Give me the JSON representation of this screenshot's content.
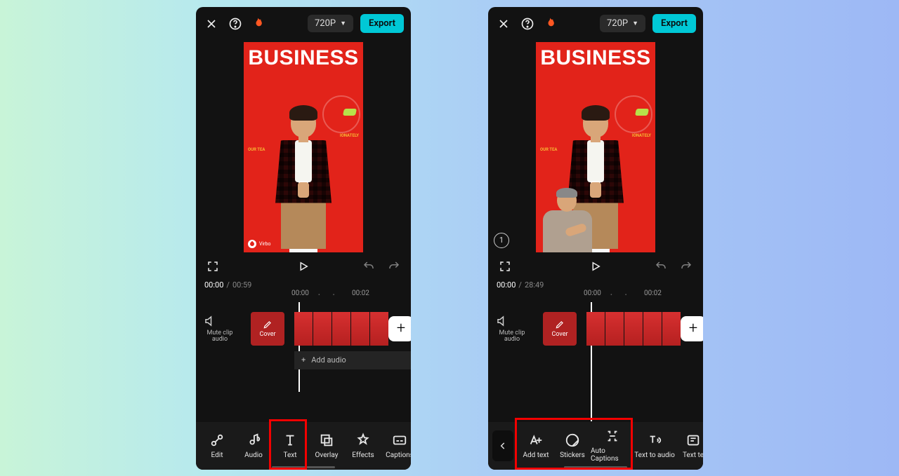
{
  "topbar": {
    "resolution": "720P",
    "export_label": "Export"
  },
  "preview": {
    "title": "BUSINESS",
    "side_text_left": "OUR TEA",
    "side_text_right": "IONATELY",
    "watermark": "Virbo"
  },
  "left": {
    "time_current": "00:00",
    "time_total": "00:59",
    "ruler": {
      "t0": "00:00",
      "t1": "00:02"
    },
    "mute_label": "Mute clip audio",
    "cover_label": "Cover",
    "add_audio_label": "Add audio",
    "tools": [
      {
        "id": "edit",
        "label": "Edit"
      },
      {
        "id": "audio",
        "label": "Audio"
      },
      {
        "id": "text",
        "label": "Text"
      },
      {
        "id": "overlay",
        "label": "Overlay"
      },
      {
        "id": "effects",
        "label": "Effects"
      },
      {
        "id": "captions",
        "label": "Captions"
      }
    ]
  },
  "right": {
    "time_current": "00:00",
    "time_total": "28:49",
    "ruler": {
      "t0": "00:00",
      "t1": "00:02"
    },
    "mute_label": "Mute clip audio",
    "cover_label": "Cover",
    "badge": "1",
    "tools": [
      {
        "id": "add-text",
        "label": "Add text"
      },
      {
        "id": "stickers",
        "label": "Stickers"
      },
      {
        "id": "auto-captions",
        "label": "Auto Captions"
      },
      {
        "id": "text-to-audio",
        "label": "Text to audio"
      },
      {
        "id": "text-templates",
        "label": "Text te"
      }
    ]
  }
}
